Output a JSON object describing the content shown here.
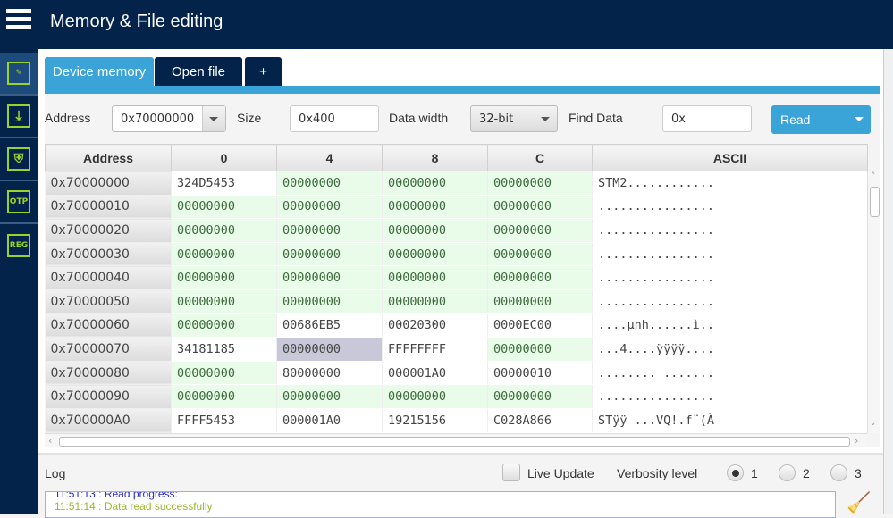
{
  "header": {
    "title": "Memory & File editing",
    "menu_icon": "hamburger-icon"
  },
  "sidebar": {
    "items": [
      {
        "name": "memory-edit",
        "icon": "pencil-edit-icon",
        "active": true
      },
      {
        "name": "download",
        "icon": "download-icon",
        "active": false
      },
      {
        "name": "security",
        "icon": "shield-icon",
        "active": false
      },
      {
        "name": "otp",
        "icon": "otp-icon",
        "label": "OTP",
        "active": false
      },
      {
        "name": "registers",
        "icon": "reg-icon",
        "label": "REG",
        "active": false
      }
    ]
  },
  "tabs": [
    {
      "label": "Device memory",
      "active": true
    },
    {
      "label": "Open file",
      "active": false
    },
    {
      "label": "+",
      "active": false
    }
  ],
  "toolbar": {
    "address_label": "Address",
    "address_value": "0x70000000",
    "size_label": "Size",
    "size_value": "0x400",
    "data_width_label": "Data width",
    "data_width_value": "32-bit",
    "find_label": "Find Data",
    "find_value": "0x",
    "read_label": "Read"
  },
  "table": {
    "headers": [
      "Address",
      "0",
      "4",
      "8",
      "C",
      "ASCII"
    ],
    "selected_cell": {
      "row": 7,
      "col": 2
    },
    "rows": [
      [
        "0x70000000",
        "324D5453",
        "00000000",
        "00000000",
        "00000000",
        "STM2............"
      ],
      [
        "0x70000010",
        "00000000",
        "00000000",
        "00000000",
        "00000000",
        "................"
      ],
      [
        "0x70000020",
        "00000000",
        "00000000",
        "00000000",
        "00000000",
        "................"
      ],
      [
        "0x70000030",
        "00000000",
        "00000000",
        "00000000",
        "00000000",
        "................"
      ],
      [
        "0x70000040",
        "00000000",
        "00000000",
        "00000000",
        "00000000",
        "................"
      ],
      [
        "0x70000050",
        "00000000",
        "00000000",
        "00000000",
        "00000000",
        "................"
      ],
      [
        "0x70000060",
        "00000000",
        "00686EB5",
        "00020300",
        "0000EC00",
        "....µnh......ì.."
      ],
      [
        "0x70000070",
        "34181185",
        "00000000",
        "FFFFFFFF",
        "00000000",
        "...4....ÿÿÿÿ...."
      ],
      [
        "0x70000080",
        "00000000",
        "80000000",
        "000001A0",
        "00000010",
        "........ ......."
      ],
      [
        "0x70000090",
        "00000000",
        "00000000",
        "00000000",
        "00000000",
        "................"
      ],
      [
        "0x700000A0",
        "FFFF5453",
        "000001A0",
        "19215156",
        "C028A866",
        "STÿÿ ...VQ!.f¨(À"
      ]
    ]
  },
  "log": {
    "label": "Log",
    "live_update_label": "Live Update",
    "live_update_checked": false,
    "verbosity_label": "Verbosity level",
    "verbosity_options": [
      "1",
      "2",
      "3"
    ],
    "verbosity_selected": "1",
    "lines": [
      {
        "text": "11:51:13 : Read progress:",
        "color": "#2a2ad0"
      },
      {
        "text": "11:51:14 : Data read successfully",
        "color": "#9ab82a"
      }
    ]
  },
  "colors": {
    "navy": "#03234b",
    "accent": "#3aa3d8",
    "icon_green": "#9ad12b",
    "zero_cell": "#e9fbe9",
    "selected_cell": "#c8c8d8"
  }
}
